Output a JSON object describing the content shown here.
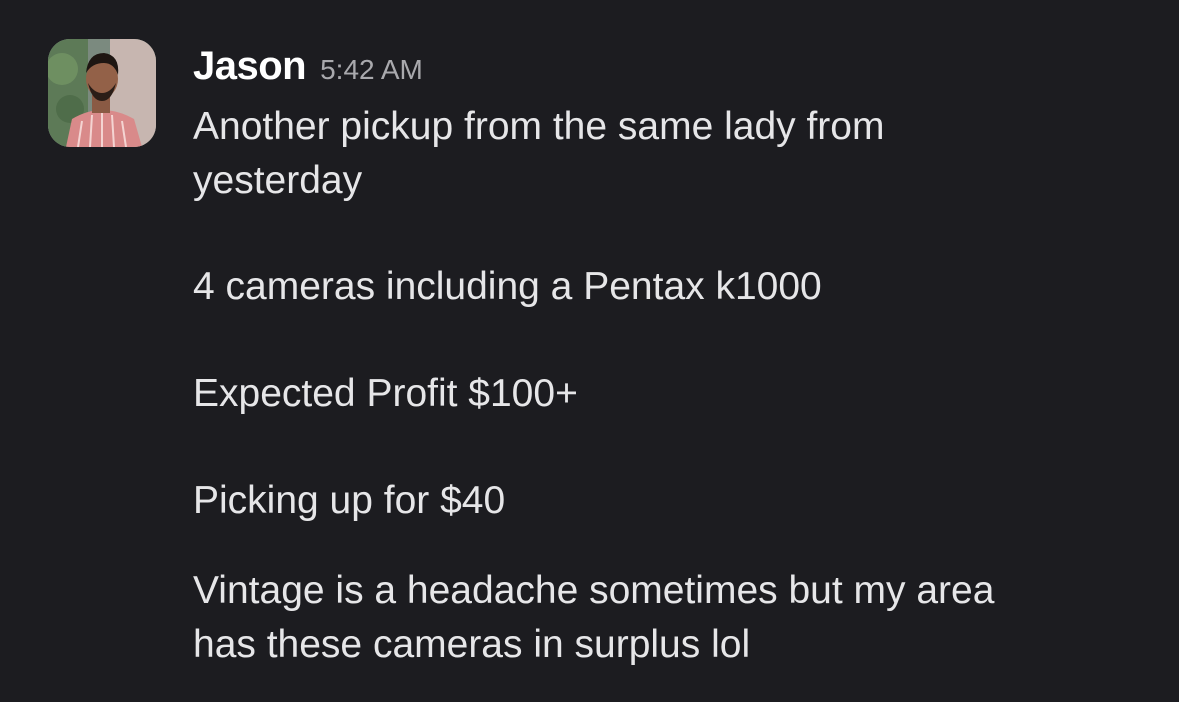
{
  "message": {
    "author": "Jason",
    "timestamp": "5:42 AM",
    "avatar_icon": "user-avatar-photo",
    "paragraphs": [
      {
        "lines": [
          "Another pickup from the same lady from",
          "yesterday"
        ]
      },
      {
        "lines": [
          "4 cameras including a Pentax k1000"
        ]
      },
      {
        "lines": [
          "Expected Profit $100+"
        ]
      },
      {
        "lines": [
          "Picking up for $40"
        ]
      },
      {
        "lines": [
          "Vintage is a headache sometimes but my area",
          "has these cameras in surplus lol"
        ]
      }
    ]
  },
  "colors": {
    "background": "#1c1c20",
    "author": "#ffffff",
    "timestamp": "#a9a9ad",
    "text": "#e6e6e8"
  }
}
